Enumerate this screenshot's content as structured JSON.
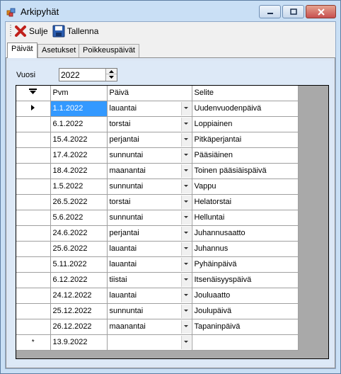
{
  "window": {
    "title": "Arkipyhät"
  },
  "toolbar": {
    "close_label": "Sulje",
    "save_label": "Tallenna"
  },
  "tabs": [
    {
      "label": "Päivät",
      "active": true
    },
    {
      "label": "Asetukset",
      "active": false
    },
    {
      "label": "Poikkeuspäivät",
      "active": false
    }
  ],
  "vuosi": {
    "label": "Vuosi",
    "value": "2022"
  },
  "grid": {
    "headers": {
      "pvm": "Pvm",
      "paiva": "Päivä",
      "selite": "Selite"
    },
    "rows": [
      {
        "pvm": "1.1.2022",
        "paiva": "lauantai",
        "selite": "Uudenvuodenpäivä"
      },
      {
        "pvm": "6.1.2022",
        "paiva": "torstai",
        "selite": "Loppiainen"
      },
      {
        "pvm": "15.4.2022",
        "paiva": "perjantai",
        "selite": "Pitkäperjantai"
      },
      {
        "pvm": "17.4.2022",
        "paiva": "sunnuntai",
        "selite": "Pääsiäinen"
      },
      {
        "pvm": "18.4.2022",
        "paiva": "maanantai",
        "selite": "Toinen pääsiäispäivä"
      },
      {
        "pvm": "1.5.2022",
        "paiva": "sunnuntai",
        "selite": "Vappu"
      },
      {
        "pvm": "26.5.2022",
        "paiva": "torstai",
        "selite": "Helatorstai"
      },
      {
        "pvm": "5.6.2022",
        "paiva": "sunnuntai",
        "selite": "Helluntai"
      },
      {
        "pvm": "24.6.2022",
        "paiva": "perjantai",
        "selite": "Juhannusaatto"
      },
      {
        "pvm": "25.6.2022",
        "paiva": "lauantai",
        "selite": "Juhannus"
      },
      {
        "pvm": "5.11.2022",
        "paiva": "lauantai",
        "selite": "Pyhäinpäivä"
      },
      {
        "pvm": "6.12.2022",
        "paiva": "tiistai",
        "selite": "Itsenäisyyspäivä"
      },
      {
        "pvm": "24.12.2022",
        "paiva": "lauantai",
        "selite": "Jouluaatto"
      },
      {
        "pvm": "25.12.2022",
        "paiva": "sunnuntai",
        "selite": "Joulupäivä"
      },
      {
        "pvm": "26.12.2022",
        "paiva": "maanantai",
        "selite": "Tapaninpäivä"
      }
    ],
    "new_row": {
      "pvm": "13.9.2022",
      "paiva": "",
      "selite": ""
    },
    "new_row_marker": "*"
  }
}
